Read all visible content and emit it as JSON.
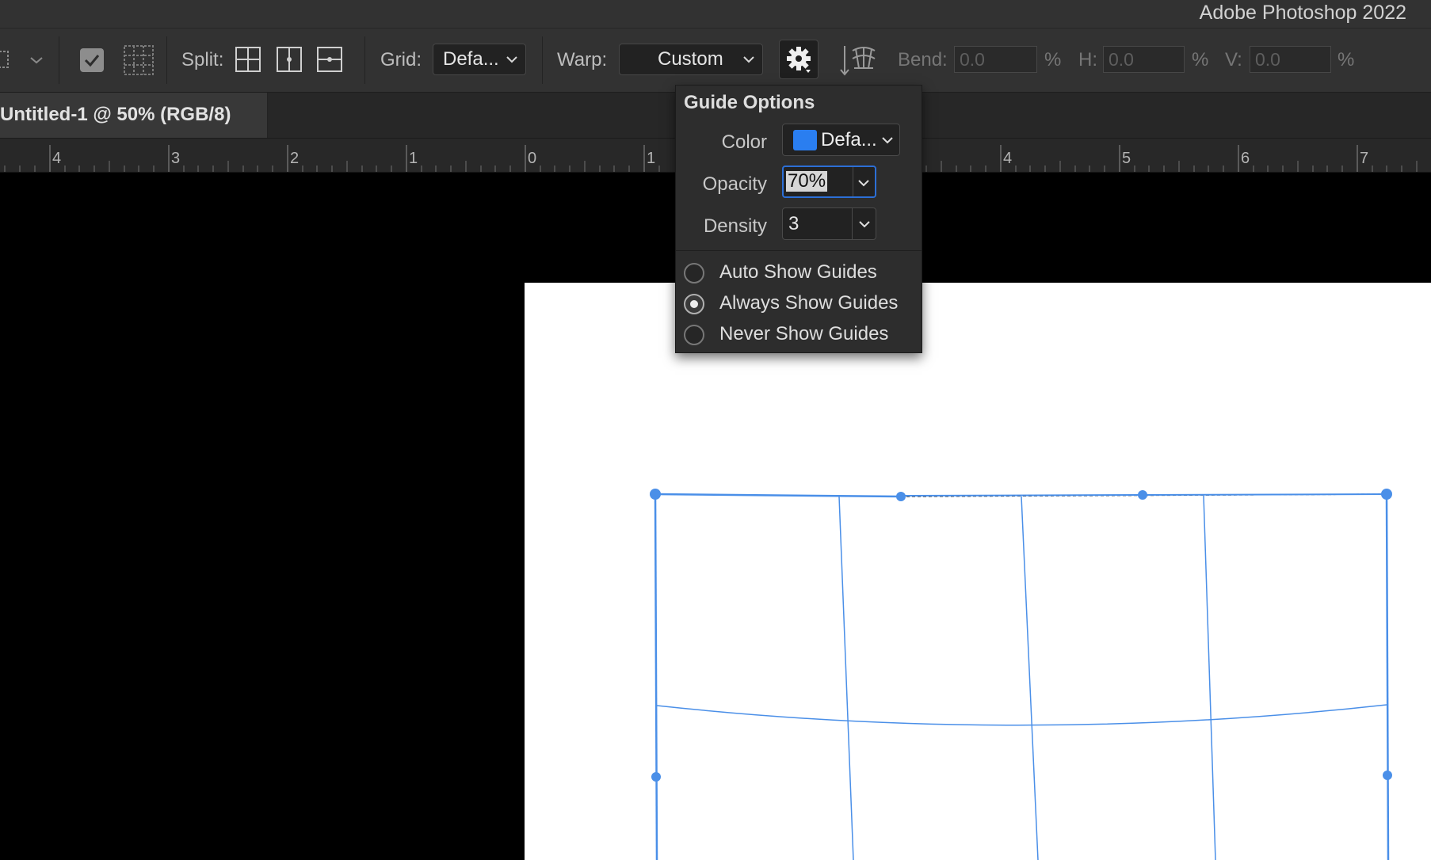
{
  "app": {
    "title": "Adobe Photoshop 2022"
  },
  "options_bar": {
    "split_label": "Split:",
    "grid_label": "Grid:",
    "grid_value": "Defa...",
    "warp_label": "Warp:",
    "warp_value": "Custom",
    "bend_label": "Bend:",
    "bend_value": "0.0",
    "h_label": "H:",
    "h_value": "0.0",
    "v_label": "V:",
    "v_value": "0.0",
    "percent": "%"
  },
  "document_tab": {
    "title": "Untitled-1 @ 50% (RGB/8)"
  },
  "ruler": {
    "ticks": [
      "4",
      "3",
      "2",
      "1",
      "0",
      "1",
      "4",
      "5",
      "6",
      "7"
    ]
  },
  "guide_options": {
    "title": "Guide Options",
    "color_label": "Color",
    "color_value": "Defa...",
    "color_swatch": "#2a7ef0",
    "opacity_label": "Opacity",
    "opacity_value": "70%",
    "density_label": "Density",
    "density_value": "3",
    "radios": [
      {
        "label": "Auto Show Guides",
        "selected": false
      },
      {
        "label": "Always Show Guides",
        "selected": true
      },
      {
        "label": "Never Show Guides",
        "selected": false
      }
    ]
  },
  "colors": {
    "guide": "#4a8fe8",
    "panel": "#323232",
    "canvas": "#ffffff"
  }
}
